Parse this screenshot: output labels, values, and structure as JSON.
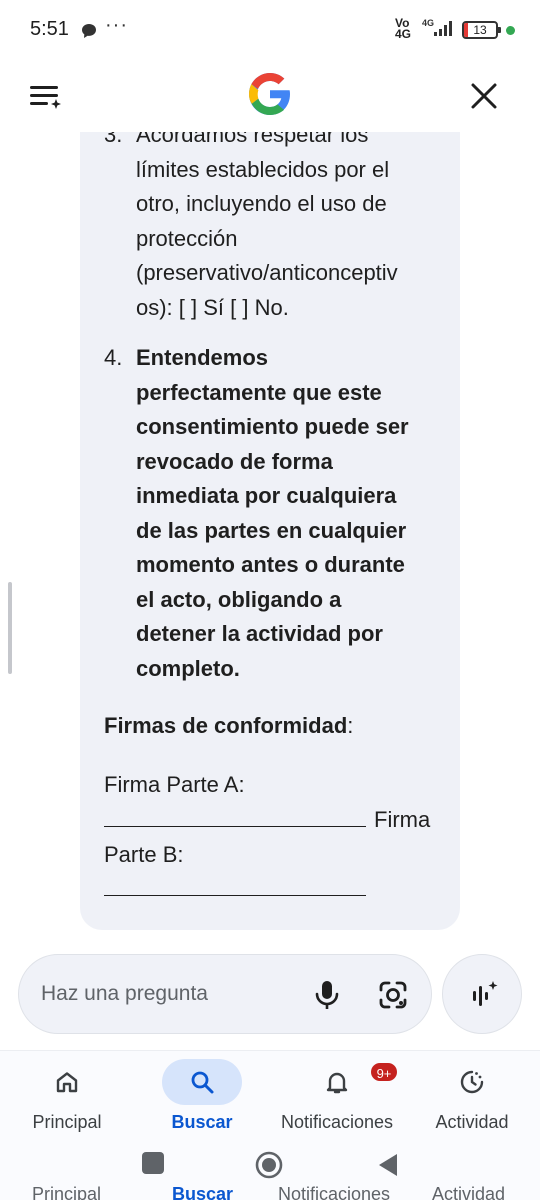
{
  "status_bar": {
    "time": "5:51",
    "extra": "···",
    "network": "Vo 4G",
    "network_line1": "Vo",
    "network_line2": "4G",
    "battery": "13"
  },
  "header": {
    "logo_letter": "G",
    "colors": {
      "blue": "#4285f4",
      "red": "#ea4335",
      "yellow": "#fbbc05",
      "green": "#34a853"
    }
  },
  "content": {
    "clauses": [
      {
        "number": "3.",
        "lines": [
          "Acordamos respetar los",
          "límites establecidos por el",
          "otro, incluyendo el uso de",
          "protección",
          "(preservativo/anticonceptiv",
          "os): [ ] Sí [ ] No."
        ]
      },
      {
        "number": "4.",
        "lines": [
          "Entendemos",
          "perfectamente que este",
          "consentimiento puede ser",
          "revocado de forma",
          "inmediata por cualquiera",
          "de las partes en cualquier",
          "momento antes o durante",
          "el acto, obligando a",
          "detener la actividad por",
          "completo."
        ]
      }
    ],
    "signatures_title": "Firmas de conformidad",
    "signatures_colon": ":",
    "sig_a_label": "Firma Parte A:",
    "sig_a_trailing": "Firma",
    "sig_b_label": "Parte B:"
  },
  "ask_bar": {
    "placeholder": "Haz una pregunta"
  },
  "bottom_nav": {
    "items": [
      {
        "label": "Principal",
        "icon": "home-icon",
        "active": false
      },
      {
        "label": "Buscar",
        "icon": "search-icon",
        "active": true
      },
      {
        "label": "Notificaciones",
        "icon": "bell-icon",
        "active": false,
        "badge": "9+"
      },
      {
        "label": "Actividad",
        "icon": "activity-icon",
        "active": false
      }
    ],
    "accent": "#0b57d0",
    "badge_color": "#c5221f"
  },
  "ghost_labels": [
    "Principal",
    "Buscar",
    "Notificaciones",
    "Actividad"
  ]
}
